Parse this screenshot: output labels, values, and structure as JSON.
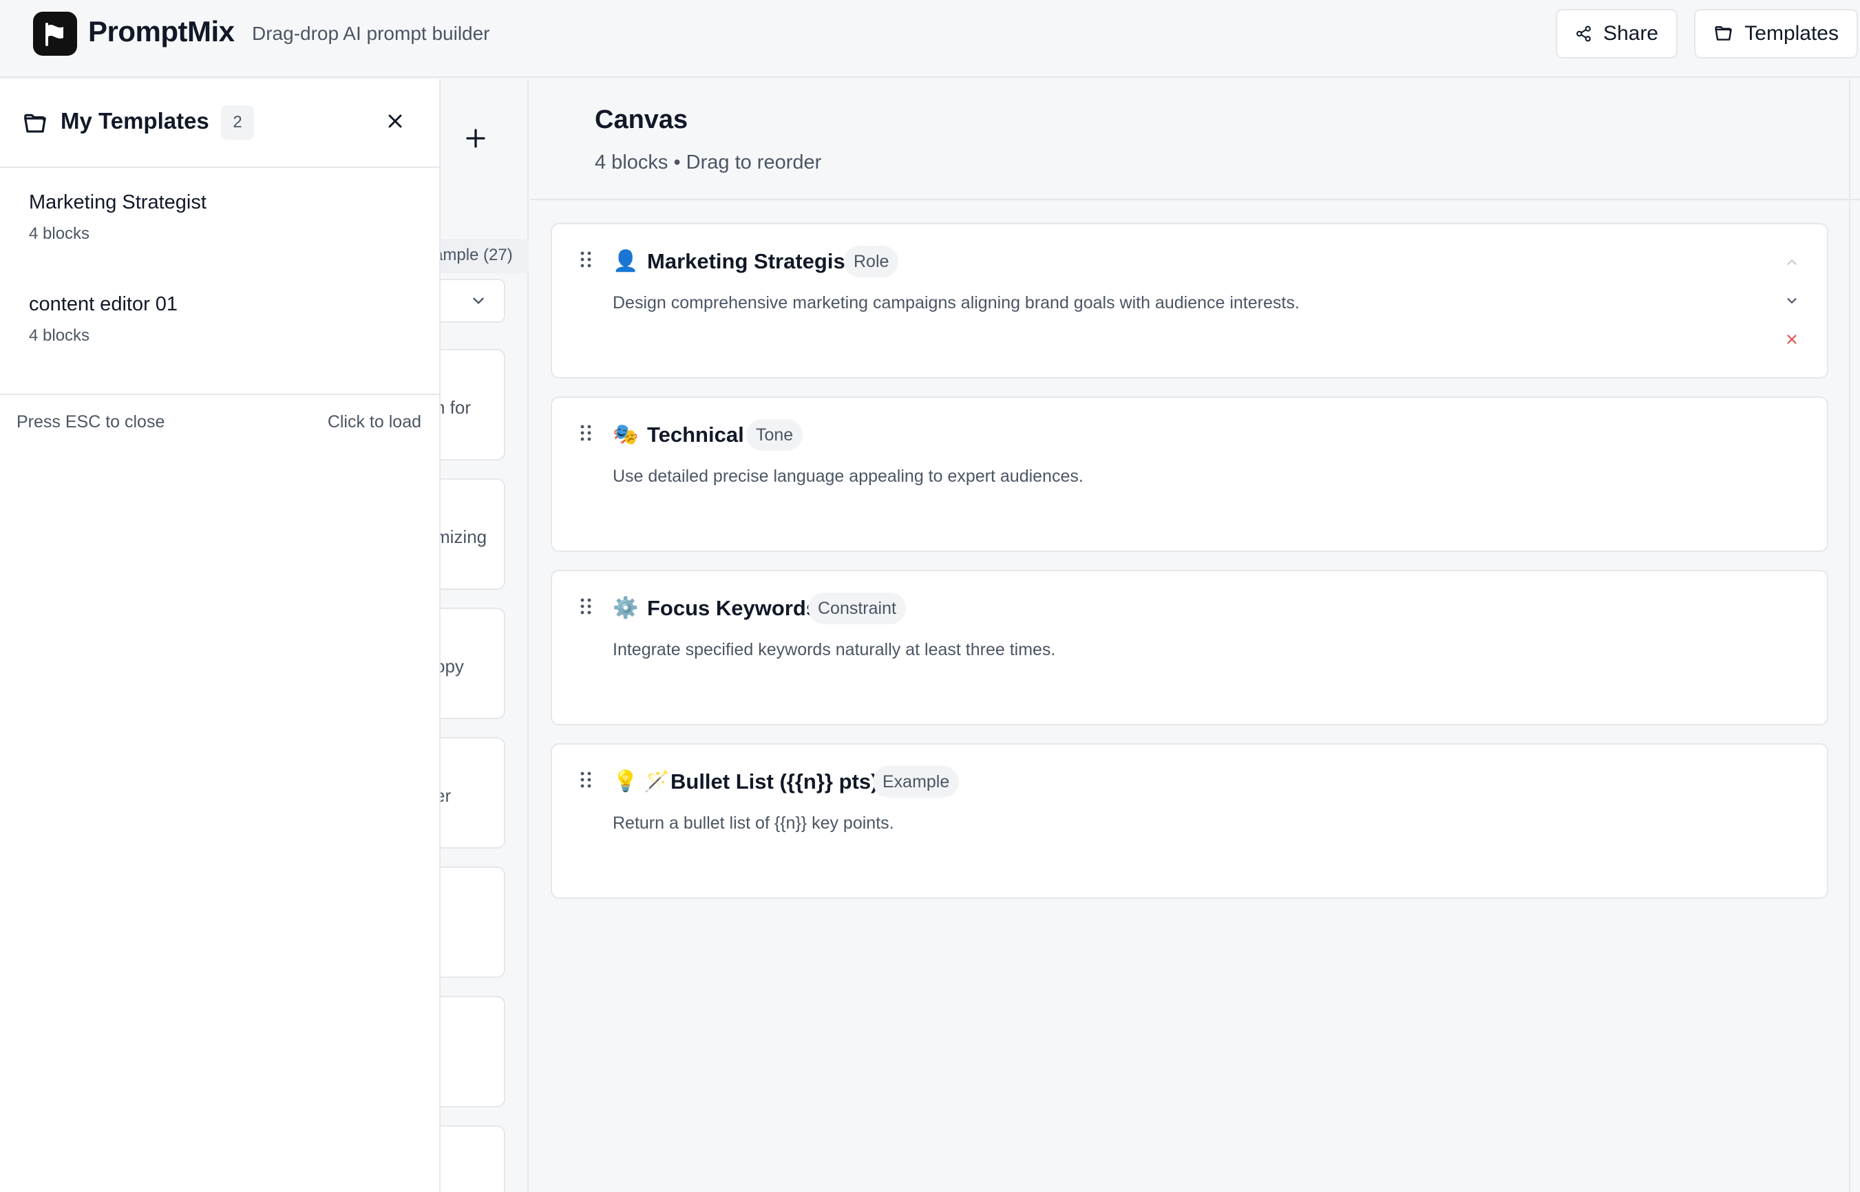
{
  "header": {
    "brand": "PromptMix",
    "tagline": "Drag-drop AI prompt builder",
    "share_label": "Share",
    "templates_label": "Templates"
  },
  "library": {
    "tab_label": "ample (27)",
    "card_fragments": [
      "n for",
      "mizing",
      "opy",
      "er"
    ]
  },
  "drawer": {
    "title": "My Templates",
    "count": "2",
    "templates": [
      {
        "name": "Marketing Strategist",
        "meta": "4 blocks"
      },
      {
        "name": "content editor 01",
        "meta": "4 blocks"
      }
    ],
    "footer_left": "Press ESC to close",
    "footer_right": "Click to load"
  },
  "canvas": {
    "title": "Canvas",
    "subtitle": "4 blocks • Drag to reorder",
    "blocks": [
      {
        "icon": "👤",
        "title": "Marketing Strategist",
        "tag": "Role",
        "desc": "Design comprehensive marketing campaigns aligning brand goals with audience interests."
      },
      {
        "icon": "🎭",
        "title": "Technical",
        "tag": "Tone",
        "desc": "Use detailed precise language appealing to expert audiences."
      },
      {
        "icon": "⚙️",
        "title": "Focus Keywords",
        "tag": "Constraint",
        "desc": "Integrate specified keywords naturally at least three times."
      },
      {
        "icon": "💡 🪄",
        "title": "Bullet List ({{n}} pts)",
        "tag": "Example",
        "desc": "Return a bullet list of {{n}} key points."
      }
    ]
  },
  "colors": {
    "accent": "#111111",
    "danger": "#e05252",
    "border": "#e5e7eb",
    "muted_text": "#4b5563"
  }
}
